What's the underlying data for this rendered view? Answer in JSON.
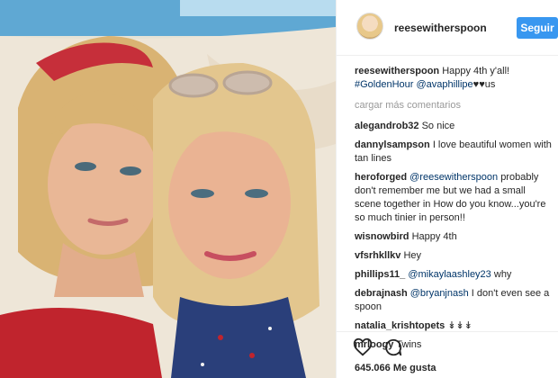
{
  "post": {
    "username": "reesewitherspoon",
    "follow_label": "Seguir",
    "caption": {
      "user": "reesewitherspoon",
      "text": "Happy 4th y'all!",
      "hashtag": "#GoldenHour",
      "mention": "@avaphillipe",
      "hearts": "♥♥",
      "tail": "us"
    },
    "load_more": "cargar más comentarios",
    "comments": [
      {
        "user": "alegandrob32",
        "text": "So nice"
      },
      {
        "user": "dannylsampson",
        "text": "I love beautiful women with tan lines"
      },
      {
        "user": "heroforged",
        "mention": "@reesewitherspoon",
        "text": "probably don't remember me but we had a small scene together in How do you know...you're so much tinier in person!!"
      },
      {
        "user": "wisnowbird",
        "text": "Happy 4th"
      },
      {
        "user": "vfsrhkllkv",
        "text": "Hey"
      },
      {
        "user": "phillips11_",
        "mention": "@mikaylaashley23",
        "text": "why"
      },
      {
        "user": "debrajnash",
        "mention": "@bryanjnash",
        "text": "I don't even see a spoon"
      },
      {
        "user": "natalia_krishtopets",
        "text": "↡↡↡"
      },
      {
        "user": "mrloogy",
        "text": "Twins"
      }
    ],
    "likes": "645.066 Me gusta"
  },
  "icons": {
    "like": "heart-outline-icon",
    "comment": "speech-bubble-icon"
  },
  "colors": {
    "follow_button": "#3897f0",
    "link": "#003569",
    "muted": "#999999"
  }
}
